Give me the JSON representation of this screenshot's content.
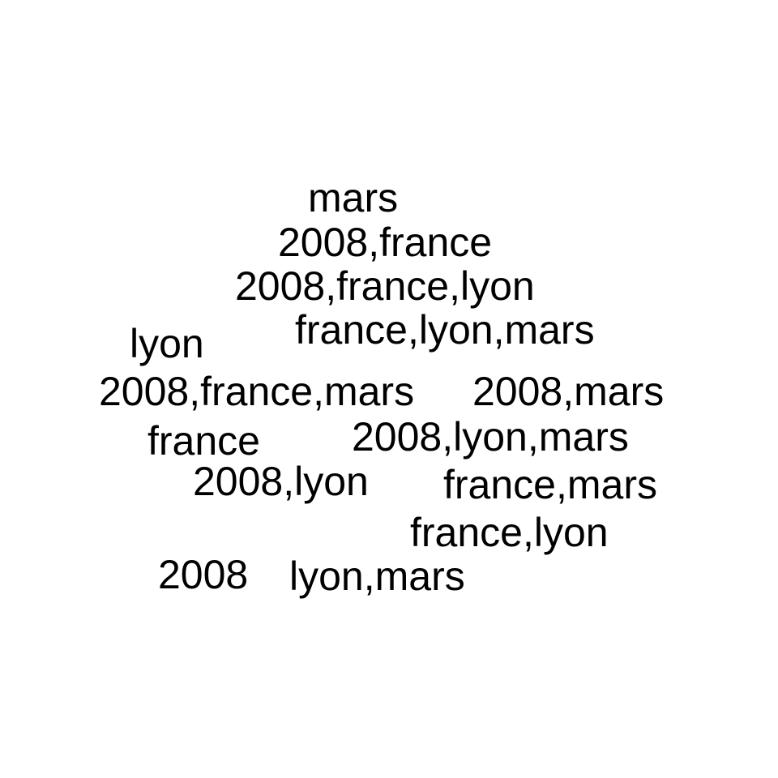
{
  "word_cloud": {
    "text_color": "#000000",
    "background_color": "#ffffff",
    "words": {
      "mars": "mars",
      "2008_france": "2008,france",
      "2008_france_lyon": "2008,france,lyon",
      "france_lyon_mars": "france,lyon,mars",
      "lyon": "lyon",
      "2008_france_mars": "2008,france,mars",
      "2008_mars": "2008,mars",
      "france": "france",
      "2008_lyon_mars": "2008,lyon,mars",
      "2008_lyon": "2008,lyon",
      "france_mars": "france,mars",
      "france_lyon": "france,lyon",
      "2008": "2008",
      "lyon_mars": "lyon,mars"
    }
  }
}
